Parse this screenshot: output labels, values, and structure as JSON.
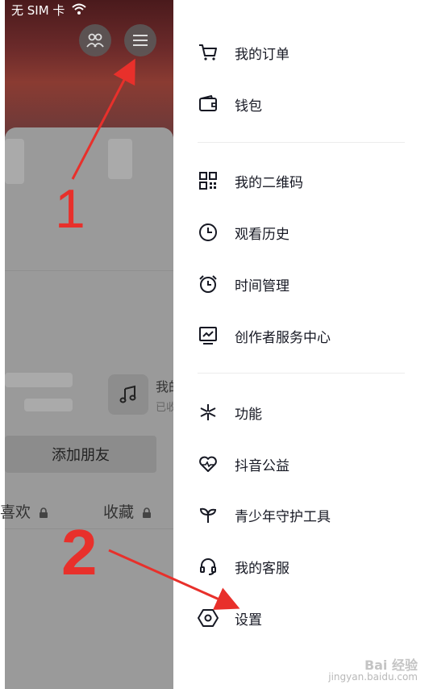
{
  "status_bar": {
    "carrier": "无 SIM 卡"
  },
  "profile_bg": {
    "music_label": "我的",
    "music_sub": "已收",
    "add_friend": "添加朋友",
    "tabs": [
      {
        "label": "喜欢"
      },
      {
        "label": "收藏"
      }
    ]
  },
  "drawer": {
    "items": [
      {
        "label": "我的订单",
        "icon": "cart-icon"
      },
      {
        "label": "钱包",
        "icon": "wallet-icon"
      },
      {
        "label": "我的二维码",
        "icon": "qr-code-icon"
      },
      {
        "label": "观看历史",
        "icon": "clock-icon"
      },
      {
        "label": "时间管理",
        "icon": "alarm-icon"
      },
      {
        "label": "创作者服务中心",
        "icon": "creator-chart-icon"
      },
      {
        "label": "功能",
        "icon": "sparkle-icon"
      },
      {
        "label": "抖音公益",
        "icon": "charity-heart-icon"
      },
      {
        "label": "青少年守护工具",
        "icon": "sprout-icon"
      },
      {
        "label": "我的客服",
        "icon": "headset-icon"
      },
      {
        "label": "设置",
        "icon": "settings-hexagon-icon"
      }
    ]
  },
  "annotations": {
    "mark_1": "1",
    "mark_2": "2"
  },
  "watermark": {
    "brand": "Bai 经验",
    "url": "jingyan.baidu.com"
  }
}
